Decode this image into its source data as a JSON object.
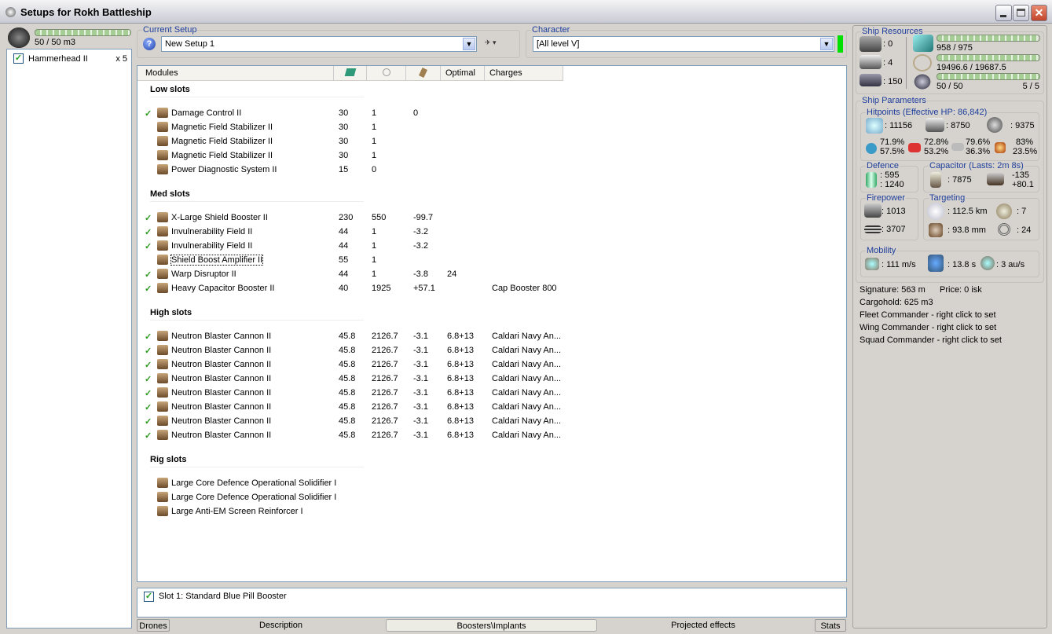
{
  "window": {
    "title": "Setups for Rokh Battleship"
  },
  "drones": {
    "capacity": "50 / 50 m3",
    "items": [
      {
        "name": "Hammerhead II",
        "qty": "x 5",
        "checked": true
      }
    ]
  },
  "current_setup": {
    "label": "Current Setup",
    "value": "New Setup 1"
  },
  "character": {
    "label": "Character",
    "value": "[All level V]",
    "status_color": "#00e000"
  },
  "modules": {
    "columns": [
      "Modules",
      "",
      "",
      "",
      "Optimal",
      "Charges"
    ],
    "sections": [
      {
        "title": "Low slots",
        "rows": [
          {
            "active": true,
            "name": "Damage Control II",
            "c1": "30",
            "c2": "1",
            "c3": "0",
            "optimal": "",
            "charges": ""
          },
          {
            "active": false,
            "name": "Magnetic Field Stabilizer II",
            "c1": "30",
            "c2": "1",
            "c3": "",
            "optimal": "",
            "charges": ""
          },
          {
            "active": false,
            "name": "Magnetic Field Stabilizer II",
            "c1": "30",
            "c2": "1",
            "c3": "",
            "optimal": "",
            "charges": ""
          },
          {
            "active": false,
            "name": "Magnetic Field Stabilizer II",
            "c1": "30",
            "c2": "1",
            "c3": "",
            "optimal": "",
            "charges": ""
          },
          {
            "active": false,
            "name": "Power Diagnostic System II",
            "c1": "15",
            "c2": "0",
            "c3": "",
            "optimal": "",
            "charges": ""
          }
        ]
      },
      {
        "title": "Med slots",
        "rows": [
          {
            "active": true,
            "name": "X-Large Shield Booster II",
            "c1": "230",
            "c2": "550",
            "c3": "-99.7",
            "optimal": "",
            "charges": ""
          },
          {
            "active": true,
            "name": "Invulnerability Field II",
            "c1": "44",
            "c2": "1",
            "c3": "-3.2",
            "optimal": "",
            "charges": ""
          },
          {
            "active": true,
            "name": "Invulnerability Field II",
            "c1": "44",
            "c2": "1",
            "c3": "-3.2",
            "optimal": "",
            "charges": ""
          },
          {
            "active": false,
            "name": "Shield Boost Amplifier II",
            "c1": "55",
            "c2": "1",
            "c3": "",
            "optimal": "",
            "charges": "",
            "focused": true
          },
          {
            "active": true,
            "name": "Warp Disruptor II",
            "c1": "44",
            "c2": "1",
            "c3": "-3.8",
            "optimal": "24",
            "charges": ""
          },
          {
            "active": true,
            "name": "Heavy Capacitor Booster II",
            "c1": "40",
            "c2": "1925",
            "c3": "+57.1",
            "optimal": "",
            "charges": "Cap Booster 800"
          }
        ]
      },
      {
        "title": "High slots",
        "rows": [
          {
            "active": true,
            "name": "Neutron Blaster Cannon II",
            "c1": "45.8",
            "c2": "2126.7",
            "c3": "-3.1",
            "optimal": "6.8+13",
            "charges": "Caldari Navy An..."
          },
          {
            "active": true,
            "name": "Neutron Blaster Cannon II",
            "c1": "45.8",
            "c2": "2126.7",
            "c3": "-3.1",
            "optimal": "6.8+13",
            "charges": "Caldari Navy An..."
          },
          {
            "active": true,
            "name": "Neutron Blaster Cannon II",
            "c1": "45.8",
            "c2": "2126.7",
            "c3": "-3.1",
            "optimal": "6.8+13",
            "charges": "Caldari Navy An..."
          },
          {
            "active": true,
            "name": "Neutron Blaster Cannon II",
            "c1": "45.8",
            "c2": "2126.7",
            "c3": "-3.1",
            "optimal": "6.8+13",
            "charges": "Caldari Navy An..."
          },
          {
            "active": true,
            "name": "Neutron Blaster Cannon II",
            "c1": "45.8",
            "c2": "2126.7",
            "c3": "-3.1",
            "optimal": "6.8+13",
            "charges": "Caldari Navy An..."
          },
          {
            "active": true,
            "name": "Neutron Blaster Cannon II",
            "c1": "45.8",
            "c2": "2126.7",
            "c3": "-3.1",
            "optimal": "6.8+13",
            "charges": "Caldari Navy An..."
          },
          {
            "active": true,
            "name": "Neutron Blaster Cannon II",
            "c1": "45.8",
            "c2": "2126.7",
            "c3": "-3.1",
            "optimal": "6.8+13",
            "charges": "Caldari Navy An..."
          },
          {
            "active": true,
            "name": "Neutron Blaster Cannon II",
            "c1": "45.8",
            "c2": "2126.7",
            "c3": "-3.1",
            "optimal": "6.8+13",
            "charges": "Caldari Navy An..."
          }
        ]
      },
      {
        "title": "Rig slots",
        "rows": [
          {
            "active": false,
            "name": "Large Core Defence Operational Solidifier I",
            "c1": "",
            "c2": "",
            "c3": "",
            "optimal": "",
            "charges": ""
          },
          {
            "active": false,
            "name": "Large Core Defence Operational Solidifier I",
            "c1": "",
            "c2": "",
            "c3": "",
            "optimal": "",
            "charges": ""
          },
          {
            "active": false,
            "name": "Large Anti-EM Screen Reinforcer I",
            "c1": "",
            "c2": "",
            "c3": "",
            "optimal": "",
            "charges": ""
          }
        ]
      }
    ]
  },
  "boosters": {
    "items": [
      {
        "label": "Slot 1: Standard Blue Pill Booster",
        "checked": true
      }
    ]
  },
  "bottom_tabs": [
    {
      "label": "Drones"
    },
    {
      "label": "Description"
    },
    {
      "label": "Boosters\\Implants",
      "active": true
    },
    {
      "label": "Projected effects"
    },
    {
      "label": "Stats"
    }
  ],
  "resources": {
    "label": "Ship Resources",
    "turrets": ": 0",
    "launchers": ": 4",
    "calibration": ": 150",
    "cpu": "958 / 975",
    "powergrid": "19496.6 / 19687.5",
    "drone_bw": "50 / 50",
    "drones_active": "5 / 5",
    "cpu_fraction": 0.983,
    "pg_fraction": 0.99,
    "bw_fraction": 1.0
  },
  "params": {
    "label": "Ship Parameters",
    "hitpoints": {
      "label": "Hitpoints (Effective HP: 86,842)",
      "shield": ": 11156",
      "armor": ": 8750",
      "structure": ": 9375",
      "resists": [
        {
          "a": "71.9%",
          "b": "57.5%"
        },
        {
          "a": "72.8%",
          "b": "53.2%"
        },
        {
          "a": "79.6%",
          "b": "36.3%"
        },
        {
          "a": "83%",
          "b": "23.5%"
        }
      ]
    },
    "defence": {
      "label": "Defence",
      "v1": ": 595",
      "v2": ": 1240"
    },
    "capacitor": {
      "label": "Capacitor (Lasts: 2m 8s)",
      "capacity": ": 7875",
      "use": "-135",
      "recharge": "+80.1"
    },
    "firepower": {
      "label": "Firepower",
      "dps": ": 1013",
      "volley": ": 3707"
    },
    "targeting": {
      "label": "Targeting",
      "range": ": 112.5 km",
      "targets": ": 7",
      "sensor": ": 93.8 mm",
      "scan": ": 24"
    },
    "mobility": {
      "label": "Mobility",
      "speed": ": 111 m/s",
      "align": ": 13.8 s",
      "warp": ": 3 au/s"
    }
  },
  "misc": {
    "signature": "Signature: 563 m",
    "price": "Price: 0 isk",
    "cargo": "Cargohold: 625 m3",
    "fleet": "Fleet Commander - right click to set",
    "wing": "Wing Commander - right click to set",
    "squad": "Squad Commander - right click to set"
  }
}
